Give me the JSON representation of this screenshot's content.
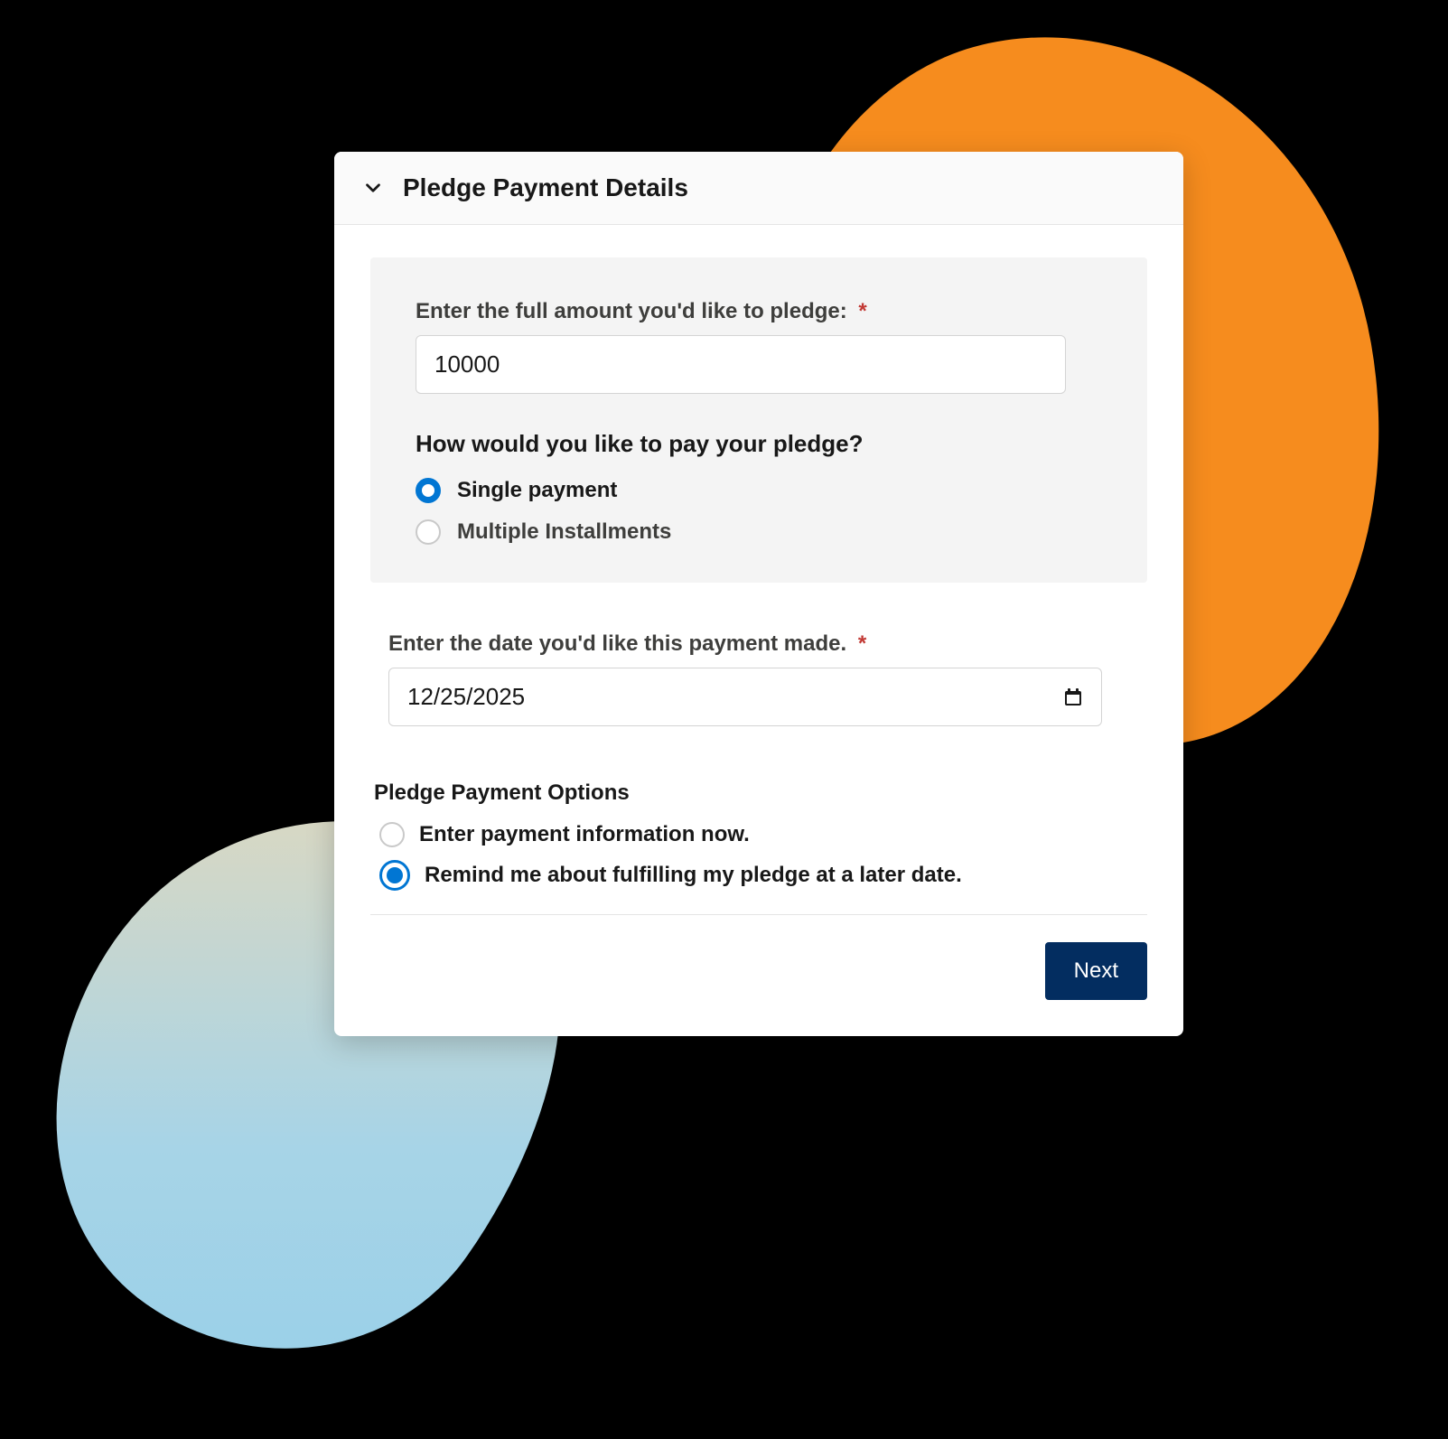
{
  "card": {
    "title": "Pledge Payment Details"
  },
  "amount": {
    "label": "Enter the full amount you'd like to pledge:",
    "value": "10000",
    "required_mark": "*"
  },
  "payment_method": {
    "question": "How would you like to pay your pledge?",
    "options": {
      "single": "Single payment",
      "multiple": "Multiple Installments"
    },
    "selected": "single"
  },
  "payment_date": {
    "label": "Enter the date you'd like this payment made.",
    "value": "12/25/2025",
    "required_mark": "*"
  },
  "payment_options": {
    "title": "Pledge Payment Options",
    "options": {
      "enter_now": "Enter payment information now.",
      "remind_later": "Remind me about fulfilling my pledge at a later date."
    },
    "selected": "remind_later"
  },
  "footer": {
    "next_label": "Next"
  }
}
